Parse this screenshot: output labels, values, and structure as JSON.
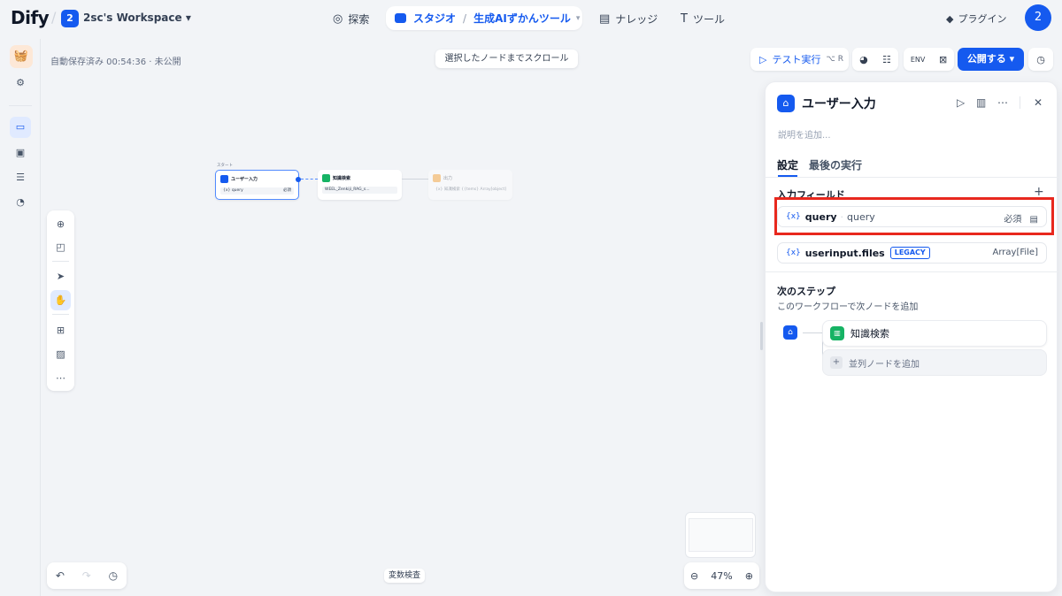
{
  "brand": {
    "logo": "Dify",
    "workspace_badge": "2",
    "workspace_name": "2sc's Workspace"
  },
  "nav": {
    "explore": "探索",
    "studio": "スタジオ",
    "app_name": "生成AIずかんツール",
    "knowledge": "ナレッジ",
    "tools": "ツール",
    "plugins": "プラグイン",
    "user_avatar": "2"
  },
  "canvas": {
    "autosave": "自動保存済み 00:54:36 · 未公開",
    "scroll_to_node": "選択したノードまでスクロール",
    "var_inspect": "変数検査",
    "zoom": "47%",
    "nodes": {
      "start_caption": "スタート",
      "start_title": "ユーザー入力",
      "start_var": "{x} query",
      "start_required": "必須",
      "knowledge_title": "知識検索",
      "knowledge_item": "WEEL_Zenkiji_RAG_s...",
      "output_title": "出力",
      "output_row": "{x} 知識検索 {{tems} Array[object]"
    }
  },
  "toolbar": {
    "test_run": "テスト実行",
    "test_run_kbd": "⌥ R",
    "env": "ENV",
    "publish": "公開する"
  },
  "panel": {
    "title": "ユーザー入力",
    "description_placeholder": "説明を追加...",
    "tabs": [
      "設定",
      "最後の実行"
    ],
    "input_fields_label": "入力フィールド",
    "fields": [
      {
        "var": "{x}",
        "name": "query",
        "label": "query",
        "required": "必須"
      },
      {
        "var": "{x}",
        "name": "userinput.files",
        "badge": "LEGACY",
        "type": "Array[File]"
      }
    ],
    "next_step_label": "次のステップ",
    "next_step_desc": "このワークフローで次ノードを追加",
    "next_node": "知識検索",
    "add_parallel": "並列ノードを追加"
  },
  "colors": {
    "accent": "#155aef",
    "highlight": "#e8281e",
    "knowledge": "#16b364"
  }
}
